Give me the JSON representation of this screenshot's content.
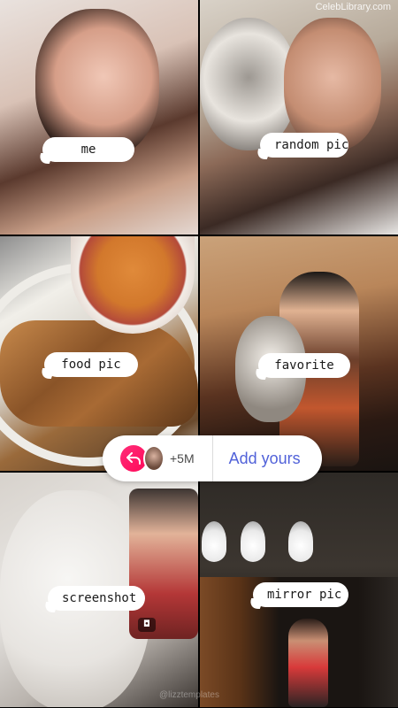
{
  "watermark_top": "CelebLibrary.com",
  "watermark_bottom": "@lizztemplates",
  "captions": {
    "me": "me",
    "random": "random pic",
    "food": "food pic",
    "favorite": "favorite",
    "screenshot": "screenshot",
    "mirror": "mirror pic"
  },
  "add_yours": {
    "count": "+5M",
    "label": "Add yours",
    "reply_icon": "reply-arrow-icon",
    "accent_color": "#ff1f6a",
    "label_color": "#5162d9"
  }
}
